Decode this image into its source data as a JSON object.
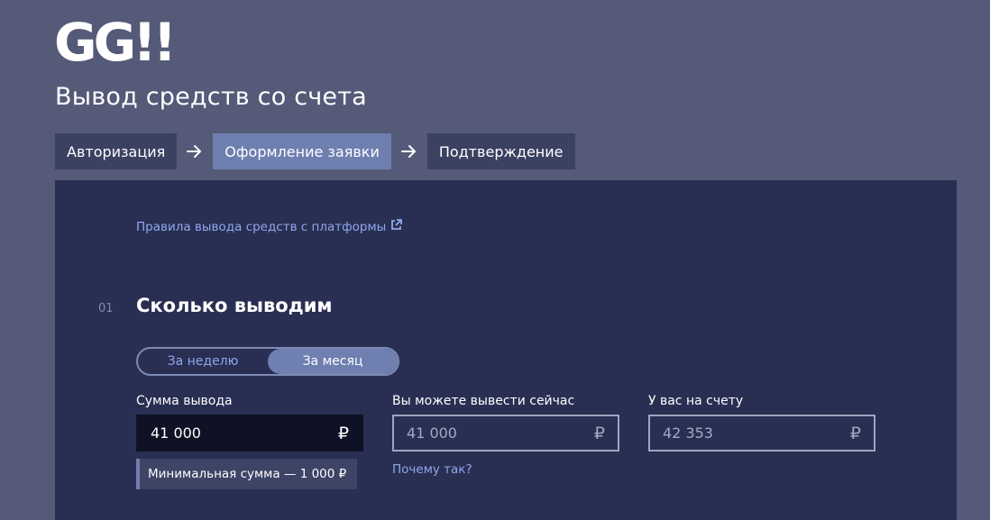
{
  "logo": {
    "text": "GG!!"
  },
  "page_title": "Вывод средств со счета",
  "steps": [
    {
      "label": "Авторизация",
      "active": false
    },
    {
      "label": "Оформление заявки",
      "active": true
    },
    {
      "label": "Подтверждение",
      "active": false
    }
  ],
  "rules_link": "Правила вывода средств с платформы",
  "section": {
    "number": "01",
    "title": "Сколько выводим"
  },
  "period_toggle": {
    "week": "За неделю",
    "month": "За месяц",
    "selected": "month"
  },
  "fields": {
    "amount": {
      "label": "Сумма вывода",
      "value": "41 000",
      "currency": "₽"
    },
    "available": {
      "label": "Вы можете вывести сейчас",
      "value": "41 000",
      "currency": "₽"
    },
    "balance": {
      "label": "У вас на счету",
      "value": "42 353",
      "currency": "₽"
    }
  },
  "min_hint": "Минимальная сумма — 1 000 ₽",
  "why_link": "Почему так?",
  "colors": {
    "background": "#545a77",
    "panel": "#292f52",
    "accent": "#6e7fb0",
    "link": "#8fa7ec"
  }
}
